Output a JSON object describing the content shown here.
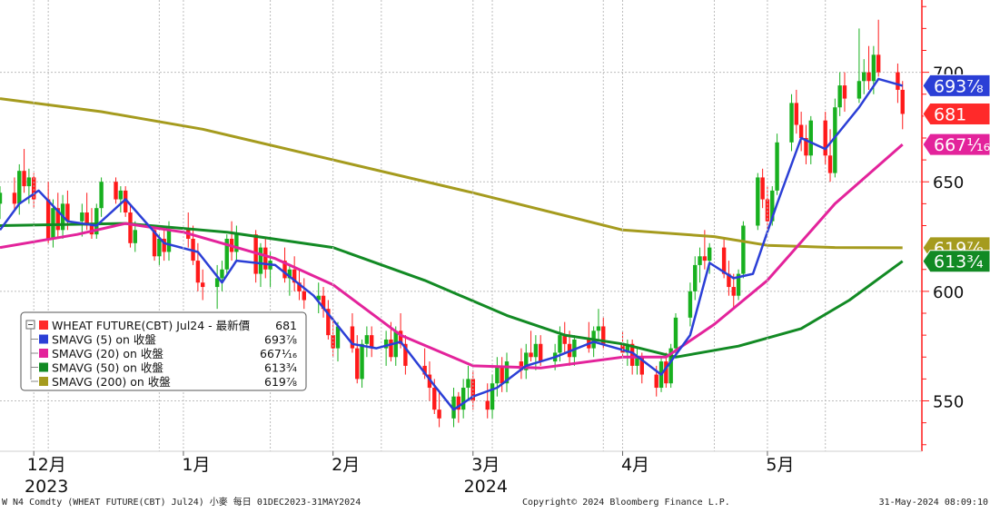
{
  "chart_data": {
    "type": "candlestick",
    "xlim": [
      "2023-11-24",
      "2024-06-02"
    ],
    "ylim": [
      527,
      733
    ],
    "y_ticks": [
      550,
      600,
      650,
      700
    ],
    "y_tick_labels": [
      "550",
      "600",
      "650",
      "700"
    ],
    "month_ticks": [
      {
        "date": "2023-12-01",
        "label": "12月",
        "year": "2023"
      },
      {
        "date": "2024-01-01",
        "label": "1月",
        "year": ""
      },
      {
        "date": "2024-02-01",
        "label": "2月",
        "year": ""
      },
      {
        "date": "2024-03-01",
        "label": "3月",
        "year": "2024"
      },
      {
        "date": "2024-04-01",
        "label": "4月",
        "year": ""
      },
      {
        "date": "2024-05-01",
        "label": "5月",
        "year": ""
      }
    ],
    "grid": true,
    "legend_position": "bottom-left",
    "legend": [
      {
        "name": "WHEAT FUTURE(CBT) Jul24 - 最新價",
        "value": "681",
        "color": "#ff2a2a"
      },
      {
        "name": "SMAVG (5)  on 收盤",
        "value": "693⅞",
        "color": "#2b3fd6"
      },
      {
        "name": "SMAVG (20)  on 收盤",
        "value": "667¹⁄₁₆",
        "color": "#e3239b"
      },
      {
        "name": "SMAVG (50)  on 收盤",
        "value": "613¾",
        "color": "#128a24"
      },
      {
        "name": "SMAVG (200)  on 收盤",
        "value": "619⅞",
        "color": "#a59b1e"
      }
    ],
    "price_tags": [
      {
        "name": "SMAVG (5)",
        "text": "693⅞",
        "value": 693.875,
        "color": "#2b3fd6"
      },
      {
        "name": "最新價",
        "text": "681",
        "value": 681,
        "color": "#ff2a2a"
      },
      {
        "name": "SMAVG (20)",
        "text": "667¹⁄₁₆",
        "value": 667.06,
        "color": "#e3239b"
      },
      {
        "name": "SMAVG (200)",
        "text": "619⅞",
        "value": 619.875,
        "color": "#a59b1e"
      },
      {
        "name": "SMAVG (50)",
        "text": "613¾",
        "value": 613.75,
        "color": "#128a24"
      }
    ],
    "ohlc": [
      [
        "2023-11-24",
        640,
        648,
        633,
        645
      ],
      [
        "2023-11-27",
        645,
        652,
        637,
        640
      ],
      [
        "2023-11-28",
        640,
        658,
        635,
        655
      ],
      [
        "2023-11-29",
        655,
        665,
        645,
        648
      ],
      [
        "2023-11-30",
        648,
        656,
        640,
        652
      ],
      [
        "2023-12-01",
        652,
        654,
        638,
        642
      ],
      [
        "2023-12-04",
        642,
        650,
        622,
        624
      ],
      [
        "2023-12-05",
        624,
        642,
        620,
        638
      ],
      [
        "2023-12-06",
        638,
        645,
        624,
        628
      ],
      [
        "2023-12-07",
        628,
        644,
        624,
        640
      ],
      [
        "2023-12-08",
        640,
        646,
        628,
        632
      ],
      [
        "2023-12-11",
        632,
        640,
        625,
        636
      ],
      [
        "2023-12-12",
        636,
        645,
        628,
        630
      ],
      [
        "2023-12-13",
        630,
        638,
        624,
        626
      ],
      [
        "2023-12-14",
        626,
        640,
        624,
        638
      ],
      [
        "2023-12-15",
        638,
        652,
        634,
        650
      ],
      [
        "2023-12-18",
        650,
        652,
        640,
        642
      ],
      [
        "2023-12-19",
        642,
        648,
        636,
        646
      ],
      [
        "2023-12-20",
        646,
        648,
        634,
        636
      ],
      [
        "2023-12-21",
        636,
        640,
        620,
        622
      ],
      [
        "2023-12-22",
        622,
        632,
        618,
        628
      ],
      [
        "2023-12-26",
        628,
        630,
        614,
        616
      ],
      [
        "2023-12-27",
        616,
        626,
        612,
        624
      ],
      [
        "2023-12-28",
        624,
        630,
        614,
        618
      ],
      [
        "2023-12-29",
        618,
        632,
        614,
        628
      ],
      [
        "2024-01-02",
        628,
        636,
        620,
        624
      ],
      [
        "2024-01-03",
        624,
        630,
        612,
        614
      ],
      [
        "2024-01-04",
        614,
        622,
        600,
        604
      ],
      [
        "2024-01-05",
        604,
        610,
        596,
        602
      ],
      [
        "2024-01-08",
        602,
        612,
        592,
        606
      ],
      [
        "2024-01-09",
        606,
        614,
        600,
        610
      ],
      [
        "2024-01-10",
        610,
        626,
        608,
        624
      ],
      [
        "2024-01-11",
        624,
        632,
        614,
        618
      ],
      [
        "2024-01-12",
        618,
        630,
        614,
        626
      ],
      [
        "2024-01-16",
        626,
        628,
        604,
        608
      ],
      [
        "2024-01-17",
        608,
        622,
        602,
        620
      ],
      [
        "2024-01-18",
        620,
        624,
        606,
        610
      ],
      [
        "2024-01-19",
        610,
        618,
        602,
        614
      ],
      [
        "2024-01-22",
        614,
        620,
        604,
        606
      ],
      [
        "2024-01-23",
        606,
        612,
        598,
        610
      ],
      [
        "2024-01-24",
        610,
        616,
        600,
        604
      ],
      [
        "2024-01-25",
        604,
        610,
        596,
        600
      ],
      [
        "2024-01-26",
        600,
        606,
        592,
        596
      ],
      [
        "2024-01-29",
        596,
        604,
        590,
        598
      ],
      [
        "2024-01-30",
        598,
        602,
        588,
        592
      ],
      [
        "2024-01-31",
        592,
        596,
        578,
        580
      ],
      [
        "2024-02-01",
        580,
        588,
        570,
        574
      ],
      [
        "2024-02-02",
        574,
        586,
        568,
        584
      ],
      [
        "2024-02-05",
        584,
        590,
        572,
        574
      ],
      [
        "2024-02-06",
        574,
        580,
        558,
        560
      ],
      [
        "2024-02-07",
        560,
        578,
        556,
        576
      ],
      [
        "2024-02-08",
        576,
        584,
        570,
        580
      ],
      [
        "2024-02-09",
        580,
        584,
        570,
        574
      ],
      [
        "2024-02-12",
        574,
        582,
        566,
        578
      ],
      [
        "2024-02-13",
        578,
        586,
        568,
        570
      ],
      [
        "2024-02-14",
        570,
        584,
        566,
        582
      ],
      [
        "2024-02-15",
        582,
        590,
        574,
        576
      ],
      [
        "2024-02-16",
        576,
        580,
        562,
        566
      ],
      [
        "2024-02-20",
        566,
        574,
        560,
        562
      ],
      [
        "2024-02-21",
        562,
        568,
        550,
        556
      ],
      [
        "2024-02-22",
        556,
        560,
        544,
        546
      ],
      [
        "2024-02-23",
        546,
        554,
        538,
        542
      ],
      [
        "2024-02-26",
        542,
        556,
        538,
        552
      ],
      [
        "2024-02-27",
        552,
        554,
        540,
        546
      ],
      [
        "2024-02-28",
        546,
        560,
        542,
        556
      ],
      [
        "2024-02-29",
        556,
        566,
        550,
        560
      ],
      [
        "2024-03-01",
        560,
        564,
        546,
        550
      ],
      [
        "2024-03-04",
        550,
        558,
        542,
        546
      ],
      [
        "2024-03-05",
        546,
        562,
        542,
        558
      ],
      [
        "2024-03-06",
        558,
        570,
        552,
        566
      ],
      [
        "2024-03-07",
        566,
        570,
        554,
        558
      ],
      [
        "2024-03-08",
        558,
        572,
        554,
        568
      ],
      [
        "2024-03-11",
        568,
        574,
        560,
        564
      ],
      [
        "2024-03-12",
        564,
        576,
        560,
        572
      ],
      [
        "2024-03-13",
        572,
        582,
        568,
        570
      ],
      [
        "2024-03-14",
        570,
        580,
        564,
        576
      ],
      [
        "2024-03-15",
        576,
        580,
        566,
        568
      ],
      [
        "2024-03-18",
        568,
        576,
        564,
        572
      ],
      [
        "2024-03-19",
        572,
        584,
        568,
        580
      ],
      [
        "2024-03-20",
        580,
        586,
        572,
        576
      ],
      [
        "2024-03-21",
        576,
        582,
        566,
        570
      ],
      [
        "2024-03-22",
        570,
        580,
        566,
        578
      ],
      [
        "2024-03-25",
        578,
        586,
        572,
        574
      ],
      [
        "2024-03-26",
        574,
        584,
        570,
        582
      ],
      [
        "2024-03-27",
        582,
        592,
        578,
        584
      ],
      [
        "2024-03-28",
        584,
        588,
        574,
        576
      ],
      [
        "2024-04-01",
        576,
        582,
        570,
        572
      ],
      [
        "2024-04-02",
        572,
        578,
        566,
        576
      ],
      [
        "2024-04-03",
        576,
        578,
        562,
        566
      ],
      [
        "2024-04-04",
        566,
        574,
        562,
        570
      ],
      [
        "2024-04-05",
        570,
        572,
        558,
        562
      ],
      [
        "2024-04-08",
        562,
        566,
        552,
        556
      ],
      [
        "2024-04-09",
        556,
        570,
        554,
        568
      ],
      [
        "2024-04-10",
        568,
        572,
        556,
        558
      ],
      [
        "2024-04-11",
        558,
        576,
        556,
        574
      ],
      [
        "2024-04-12",
        574,
        590,
        570,
        588
      ],
      [
        "2024-04-15",
        588,
        604,
        584,
        600
      ],
      [
        "2024-04-16",
        600,
        616,
        596,
        612
      ],
      [
        "2024-04-17",
        612,
        620,
        604,
        616
      ],
      [
        "2024-04-18",
        616,
        628,
        610,
        614
      ],
      [
        "2024-04-19",
        614,
        622,
        608,
        620
      ],
      [
        "2024-04-22",
        620,
        624,
        606,
        608
      ],
      [
        "2024-04-23",
        608,
        614,
        598,
        602
      ],
      [
        "2024-04-24",
        602,
        608,
        592,
        598
      ],
      [
        "2024-04-25",
        598,
        610,
        596,
        608
      ],
      [
        "2024-04-26",
        608,
        632,
        606,
        630
      ],
      [
        "2024-04-29",
        630,
        654,
        628,
        652
      ],
      [
        "2024-04-30",
        652,
        656,
        638,
        642
      ],
      [
        "2024-05-01",
        642,
        648,
        628,
        632
      ],
      [
        "2024-05-02",
        632,
        648,
        630,
        646
      ],
      [
        "2024-05-03",
        646,
        672,
        644,
        668
      ],
      [
        "2024-05-06",
        668,
        690,
        664,
        686
      ],
      [
        "2024-05-07",
        686,
        692,
        672,
        676
      ],
      [
        "2024-05-08",
        676,
        682,
        664,
        670
      ],
      [
        "2024-05-09",
        670,
        676,
        658,
        662
      ],
      [
        "2024-05-10",
        662,
        680,
        658,
        678
      ],
      [
        "2024-05-13",
        678,
        682,
        658,
        662
      ],
      [
        "2024-05-14",
        662,
        674,
        650,
        654
      ],
      [
        "2024-05-15",
        654,
        688,
        652,
        684
      ],
      [
        "2024-05-16",
        684,
        700,
        680,
        694
      ],
      [
        "2024-05-17",
        694,
        700,
        682,
        688
      ],
      [
        "2024-05-20",
        688,
        720,
        686,
        696
      ],
      [
        "2024-05-21",
        696,
        706,
        690,
        700
      ],
      [
        "2024-05-22",
        700,
        712,
        692,
        696
      ],
      [
        "2024-05-23",
        696,
        712,
        690,
        708
      ],
      [
        "2024-05-24",
        708,
        724,
        698,
        700
      ],
      [
        "2024-05-28",
        700,
        704,
        686,
        692
      ],
      [
        "2024-05-29",
        692,
        696,
        674,
        681
      ]
    ],
    "sma_series": [
      {
        "name": "SMAVG (200)",
        "color": "#a59b1e",
        "width": 3,
        "points": [
          [
            "2023-11-24",
            688
          ],
          [
            "2023-12-15",
            682
          ],
          [
            "2024-01-05",
            674
          ],
          [
            "2024-02-01",
            660
          ],
          [
            "2024-03-01",
            645
          ],
          [
            "2024-04-01",
            628
          ],
          [
            "2024-04-20",
            625
          ],
          [
            "2024-05-01",
            621
          ],
          [
            "2024-05-15",
            620
          ],
          [
            "2024-05-29",
            619.9
          ]
        ]
      },
      {
        "name": "SMAVG (50)",
        "color": "#128a24",
        "width": 3,
        "points": [
          [
            "2023-11-24",
            630
          ],
          [
            "2023-12-20",
            631
          ],
          [
            "2024-01-10",
            627
          ],
          [
            "2024-02-01",
            620
          ],
          [
            "2024-02-20",
            605
          ],
          [
            "2024-03-08",
            589
          ],
          [
            "2024-03-20",
            580
          ],
          [
            "2024-04-01",
            576
          ],
          [
            "2024-04-12",
            570
          ],
          [
            "2024-04-25",
            575
          ],
          [
            "2024-05-08",
            583
          ],
          [
            "2024-05-18",
            596
          ],
          [
            "2024-05-29",
            613.75
          ]
        ]
      },
      {
        "name": "SMAVG (20)",
        "color": "#e3239b",
        "width": 3,
        "points": [
          [
            "2023-11-24",
            620
          ],
          [
            "2023-12-10",
            626
          ],
          [
            "2023-12-20",
            631
          ],
          [
            "2024-01-01",
            627
          ],
          [
            "2024-01-20",
            615
          ],
          [
            "2024-02-01",
            603
          ],
          [
            "2024-02-15",
            580
          ],
          [
            "2024-03-01",
            566
          ],
          [
            "2024-03-15",
            565
          ],
          [
            "2024-04-01",
            570
          ],
          [
            "2024-04-10",
            570
          ],
          [
            "2024-04-20",
            585
          ],
          [
            "2024-05-01",
            605
          ],
          [
            "2024-05-15",
            640
          ],
          [
            "2024-05-29",
            667.06
          ]
        ]
      },
      {
        "name": "SMAVG (5)",
        "color": "#2b3fd6",
        "width": 2.5,
        "points": [
          [
            "2023-11-24",
            628
          ],
          [
            "2023-11-28",
            640
          ],
          [
            "2023-12-02",
            646
          ],
          [
            "2023-12-08",
            632
          ],
          [
            "2023-12-14",
            630
          ],
          [
            "2023-12-20",
            642
          ],
          [
            "2023-12-28",
            622
          ],
          [
            "2024-01-04",
            618
          ],
          [
            "2024-01-09",
            604
          ],
          [
            "2024-01-12",
            614
          ],
          [
            "2024-01-20",
            612
          ],
          [
            "2024-01-28",
            598
          ],
          [
            "2024-02-05",
            576
          ],
          [
            "2024-02-10",
            574
          ],
          [
            "2024-02-15",
            577
          ],
          [
            "2024-02-22",
            557
          ],
          [
            "2024-02-26",
            546
          ],
          [
            "2024-03-01",
            552
          ],
          [
            "2024-03-06",
            556
          ],
          [
            "2024-03-12",
            566
          ],
          [
            "2024-03-18",
            570
          ],
          [
            "2024-03-26",
            577
          ],
          [
            "2024-04-03",
            572
          ],
          [
            "2024-04-09",
            562
          ],
          [
            "2024-04-15",
            580
          ],
          [
            "2024-04-19",
            613
          ],
          [
            "2024-04-24",
            606
          ],
          [
            "2024-04-28",
            608
          ],
          [
            "2024-05-03",
            640
          ],
          [
            "2024-05-08",
            670
          ],
          [
            "2024-05-13",
            665
          ],
          [
            "2024-05-20",
            684
          ],
          [
            "2024-05-24",
            697
          ],
          [
            "2024-05-29",
            693.875
          ]
        ]
      }
    ]
  },
  "footer": {
    "left": "W N4 Comdty (WHEAT FUTURE(CBT) Jul24) 小麥  每日 01DEC2023-31MAY2024",
    "center": "Copyright© 2024 Bloomberg Finance L.P.",
    "right": "31-May-2024 08:09:10"
  },
  "colors": {
    "up": "#18b01f",
    "down": "#ff1a1a",
    "grid": "#bdbdbd",
    "axis": "#ff1a1a"
  }
}
